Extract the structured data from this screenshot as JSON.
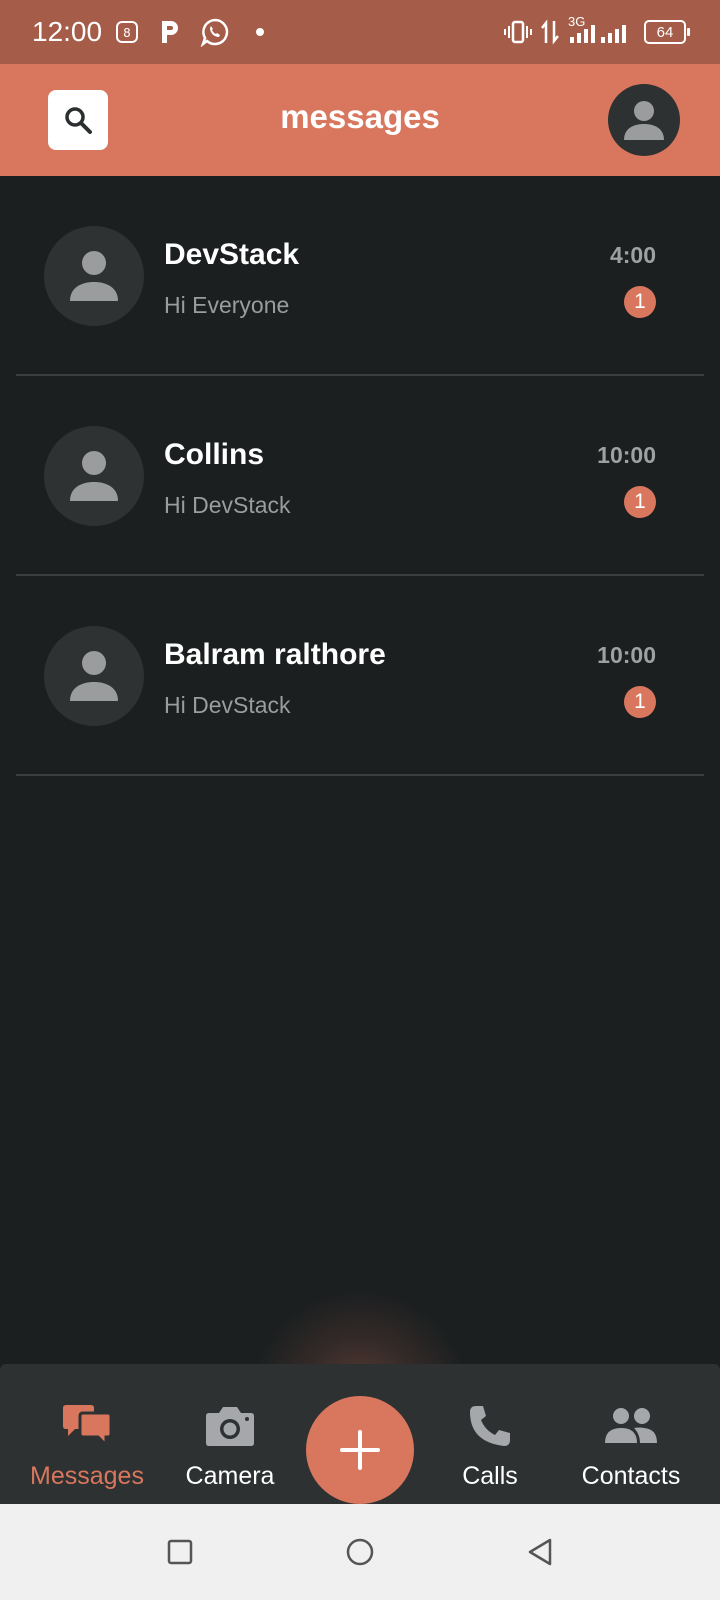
{
  "status_bar": {
    "time": "12:00",
    "network_label": "3G",
    "battery": "64",
    "icons": [
      "app-notification-icon",
      "parking-icon",
      "whatsapp-icon",
      "dot-icon",
      "vibrate-icon",
      "data-transfer-icon",
      "signal-icon",
      "battery-icon"
    ]
  },
  "header": {
    "title": "messages",
    "search_icon": "search-icon",
    "profile_icon": "person-icon"
  },
  "chats": [
    {
      "name": "DevStack",
      "preview": "Hi Everyone",
      "time": "4:00",
      "unread": "1"
    },
    {
      "name": "Collins",
      "preview": "Hi DevStack",
      "time": "10:00",
      "unread": "1"
    },
    {
      "name": "Balram ralthore",
      "preview": "Hi DevStack",
      "time": "10:00",
      "unread": "1"
    }
  ],
  "bottom_nav": {
    "items": [
      {
        "label": "Messages",
        "icon": "chat-bubbles-icon",
        "active": true
      },
      {
        "label": "Camera",
        "icon": "camera-icon",
        "active": false
      },
      {
        "label": "Calls",
        "icon": "phone-icon",
        "active": false
      },
      {
        "label": "Contacts",
        "icon": "people-icon",
        "active": false
      }
    ],
    "fab_icon": "plus-icon"
  },
  "colors": {
    "status_bar": "#a55c48",
    "accent": "#d9775e",
    "background": "#1c1f20",
    "nav_background": "#2d3131",
    "system_nav": "#f0f0f0"
  }
}
